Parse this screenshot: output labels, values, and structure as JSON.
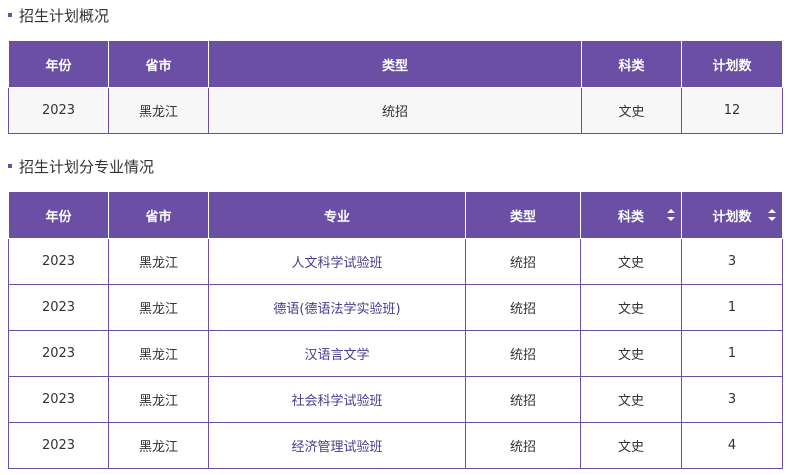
{
  "section1": {
    "title": "招生计划概况",
    "headers": [
      "年份",
      "省市",
      "类型",
      "科类",
      "计划数"
    ],
    "rows": [
      [
        "2023",
        "黑龙江",
        "统招",
        "文史",
        "12"
      ]
    ]
  },
  "section2": {
    "title": "招生计划分专业情况",
    "headers": [
      "年份",
      "省市",
      "专业",
      "类型",
      "科类",
      "计划数"
    ],
    "rows": [
      [
        "2023",
        "黑龙江",
        "人文科学试验班",
        "统招",
        "文史",
        "3"
      ],
      [
        "2023",
        "黑龙江",
        "德语(德语法学实验班)",
        "统招",
        "文史",
        "1"
      ],
      [
        "2023",
        "黑龙江",
        "汉语言文学",
        "统招",
        "文史",
        "1"
      ],
      [
        "2023",
        "黑龙江",
        "社会科学试验班",
        "统招",
        "文史",
        "3"
      ],
      [
        "2023",
        "黑龙江",
        "经济管理试验班",
        "统招",
        "文史",
        "4"
      ]
    ]
  },
  "colors": {
    "accent": "#6a4fa5",
    "major_text": "#4a3a8c"
  }
}
